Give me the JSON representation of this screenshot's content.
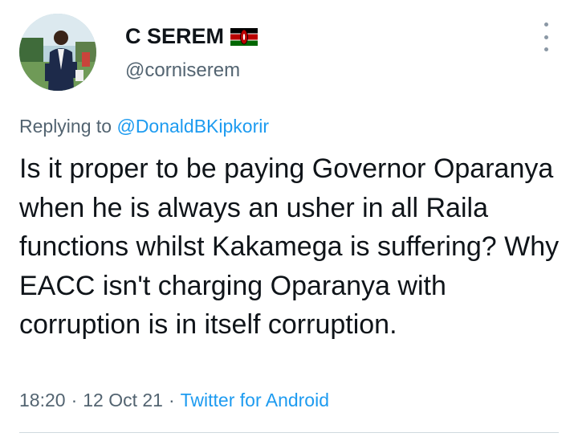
{
  "user": {
    "display_name": "C SEREM",
    "handle": "@corniserem",
    "flag_icon": "kenya-flag-icon",
    "avatar_icon": "user-avatar-photo"
  },
  "reply": {
    "prefix": "Replying to",
    "mention": "@DonaldBKipkorir"
  },
  "tweet": {
    "text": "Is it proper to be paying Governor Oparanya when he is always an usher in all Raila functions whilst Kakamega is suffering? Why EACC isn't charging Oparanya with corruption is in itself corruption."
  },
  "meta": {
    "time": "18:20",
    "date": "12 Oct 21",
    "separator": "·",
    "source": "Twitter for Android"
  },
  "colors": {
    "text": "#0f1419",
    "secondary": "#536471",
    "link": "#1d9bf0"
  }
}
